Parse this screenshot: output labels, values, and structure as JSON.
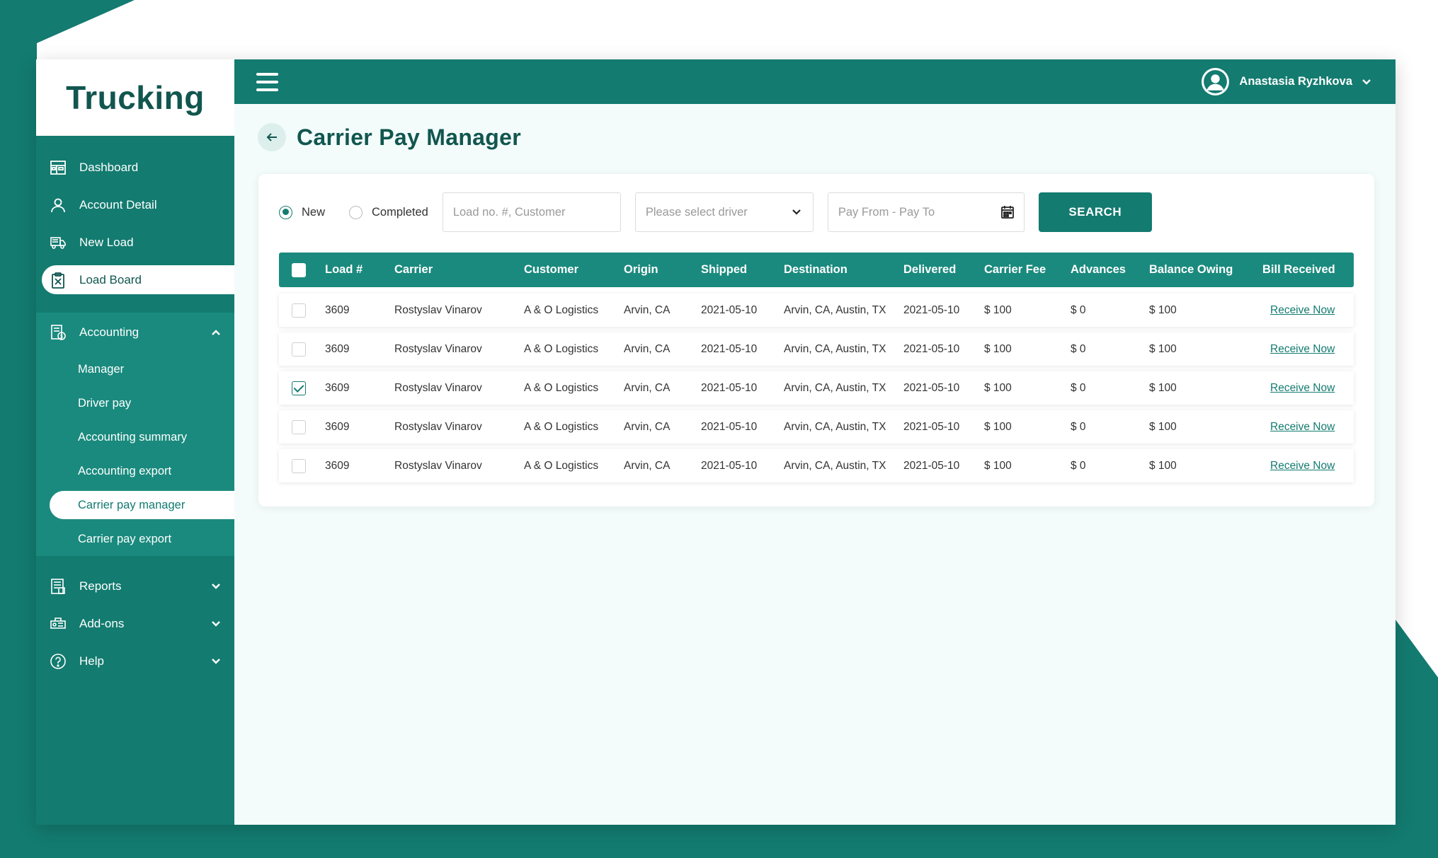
{
  "app": {
    "logo": "Trucking"
  },
  "sidebar": {
    "items": [
      {
        "label": "Dashboard",
        "icon": "dashboard-icon"
      },
      {
        "label": "Account Detail",
        "icon": "user-icon"
      },
      {
        "label": "New Load",
        "icon": "truck-icon"
      },
      {
        "label": "Load Board",
        "icon": "clipboard-icon",
        "active": true
      }
    ],
    "accounting": {
      "label": "Accounting",
      "expanded": true,
      "sub_items": [
        {
          "label": "Manager"
        },
        {
          "label": "Driver pay"
        },
        {
          "label": "Accounting summary"
        },
        {
          "label": "Accounting export"
        },
        {
          "label": "Carrier pay manager",
          "active": true
        },
        {
          "label": "Carrier pay export"
        }
      ]
    },
    "lower": [
      {
        "label": "Reports",
        "icon": "reports-icon"
      },
      {
        "label": "Add-ons",
        "icon": "addons-icon"
      },
      {
        "label": "Help",
        "icon": "help-icon"
      }
    ]
  },
  "header": {
    "user_name": "Anastasia Ryzhkova"
  },
  "page": {
    "title": "Carrier Pay Manager"
  },
  "filters": {
    "radio_new": "New",
    "radio_completed": "Completed",
    "selected": "New",
    "search_placeholder": "Load no. #, Customer",
    "driver_placeholder": "Please select driver",
    "date_placeholder": "Pay From - Pay To",
    "search_button": "SEARCH"
  },
  "table": {
    "columns": [
      "Load #",
      "Carrier",
      "Customer",
      "Origin",
      "Shipped",
      "Destination",
      "Delivered",
      "Carrier Fee",
      "Advances",
      "Balance Owing",
      "Bill Received"
    ],
    "rows": [
      {
        "checked": false,
        "load": "3609",
        "carrier": "Rostyslav Vinarov",
        "customer": "A & O Logistics",
        "origin": "Arvin, CA",
        "shipped": "2021-05-10",
        "destination": "Arvin, CA, Austin, TX",
        "delivered": "2021-05-10",
        "fee": "$ 100",
        "advances": "$ 0",
        "balance": "$ 100",
        "bill": "Receive Now"
      },
      {
        "checked": false,
        "load": "3609",
        "carrier": "Rostyslav Vinarov",
        "customer": "A & O Logistics",
        "origin": "Arvin, CA",
        "shipped": "2021-05-10",
        "destination": "Arvin, CA, Austin, TX",
        "delivered": "2021-05-10",
        "fee": "$ 100",
        "advances": "$ 0",
        "balance": "$ 100",
        "bill": "Receive Now"
      },
      {
        "checked": true,
        "load": "3609",
        "carrier": "Rostyslav Vinarov",
        "customer": "A & O Logistics",
        "origin": "Arvin, CA",
        "shipped": "2021-05-10",
        "destination": "Arvin, CA, Austin, TX",
        "delivered": "2021-05-10",
        "fee": "$ 100",
        "advances": "$ 0",
        "balance": "$ 100",
        "bill": "Receive Now"
      },
      {
        "checked": false,
        "load": "3609",
        "carrier": "Rostyslav Vinarov",
        "customer": "A & O Logistics",
        "origin": "Arvin, CA",
        "shipped": "2021-05-10",
        "destination": "Arvin, CA, Austin, TX",
        "delivered": "2021-05-10",
        "fee": "$ 100",
        "advances": "$ 0",
        "balance": "$ 100",
        "bill": "Receive Now"
      },
      {
        "checked": false,
        "load": "3609",
        "carrier": "Rostyslav Vinarov",
        "customer": "A & O Logistics",
        "origin": "Arvin, CA",
        "shipped": "2021-05-10",
        "destination": "Arvin, CA, Austin, TX",
        "delivered": "2021-05-10",
        "fee": "$ 100",
        "advances": "$ 0",
        "balance": "$ 100",
        "bill": "Receive Now"
      }
    ]
  },
  "colors": {
    "primary": "#137b70",
    "primary_dark": "#11564f",
    "table_header": "#1a8a7e",
    "page_bg": "#f3fcfb"
  }
}
